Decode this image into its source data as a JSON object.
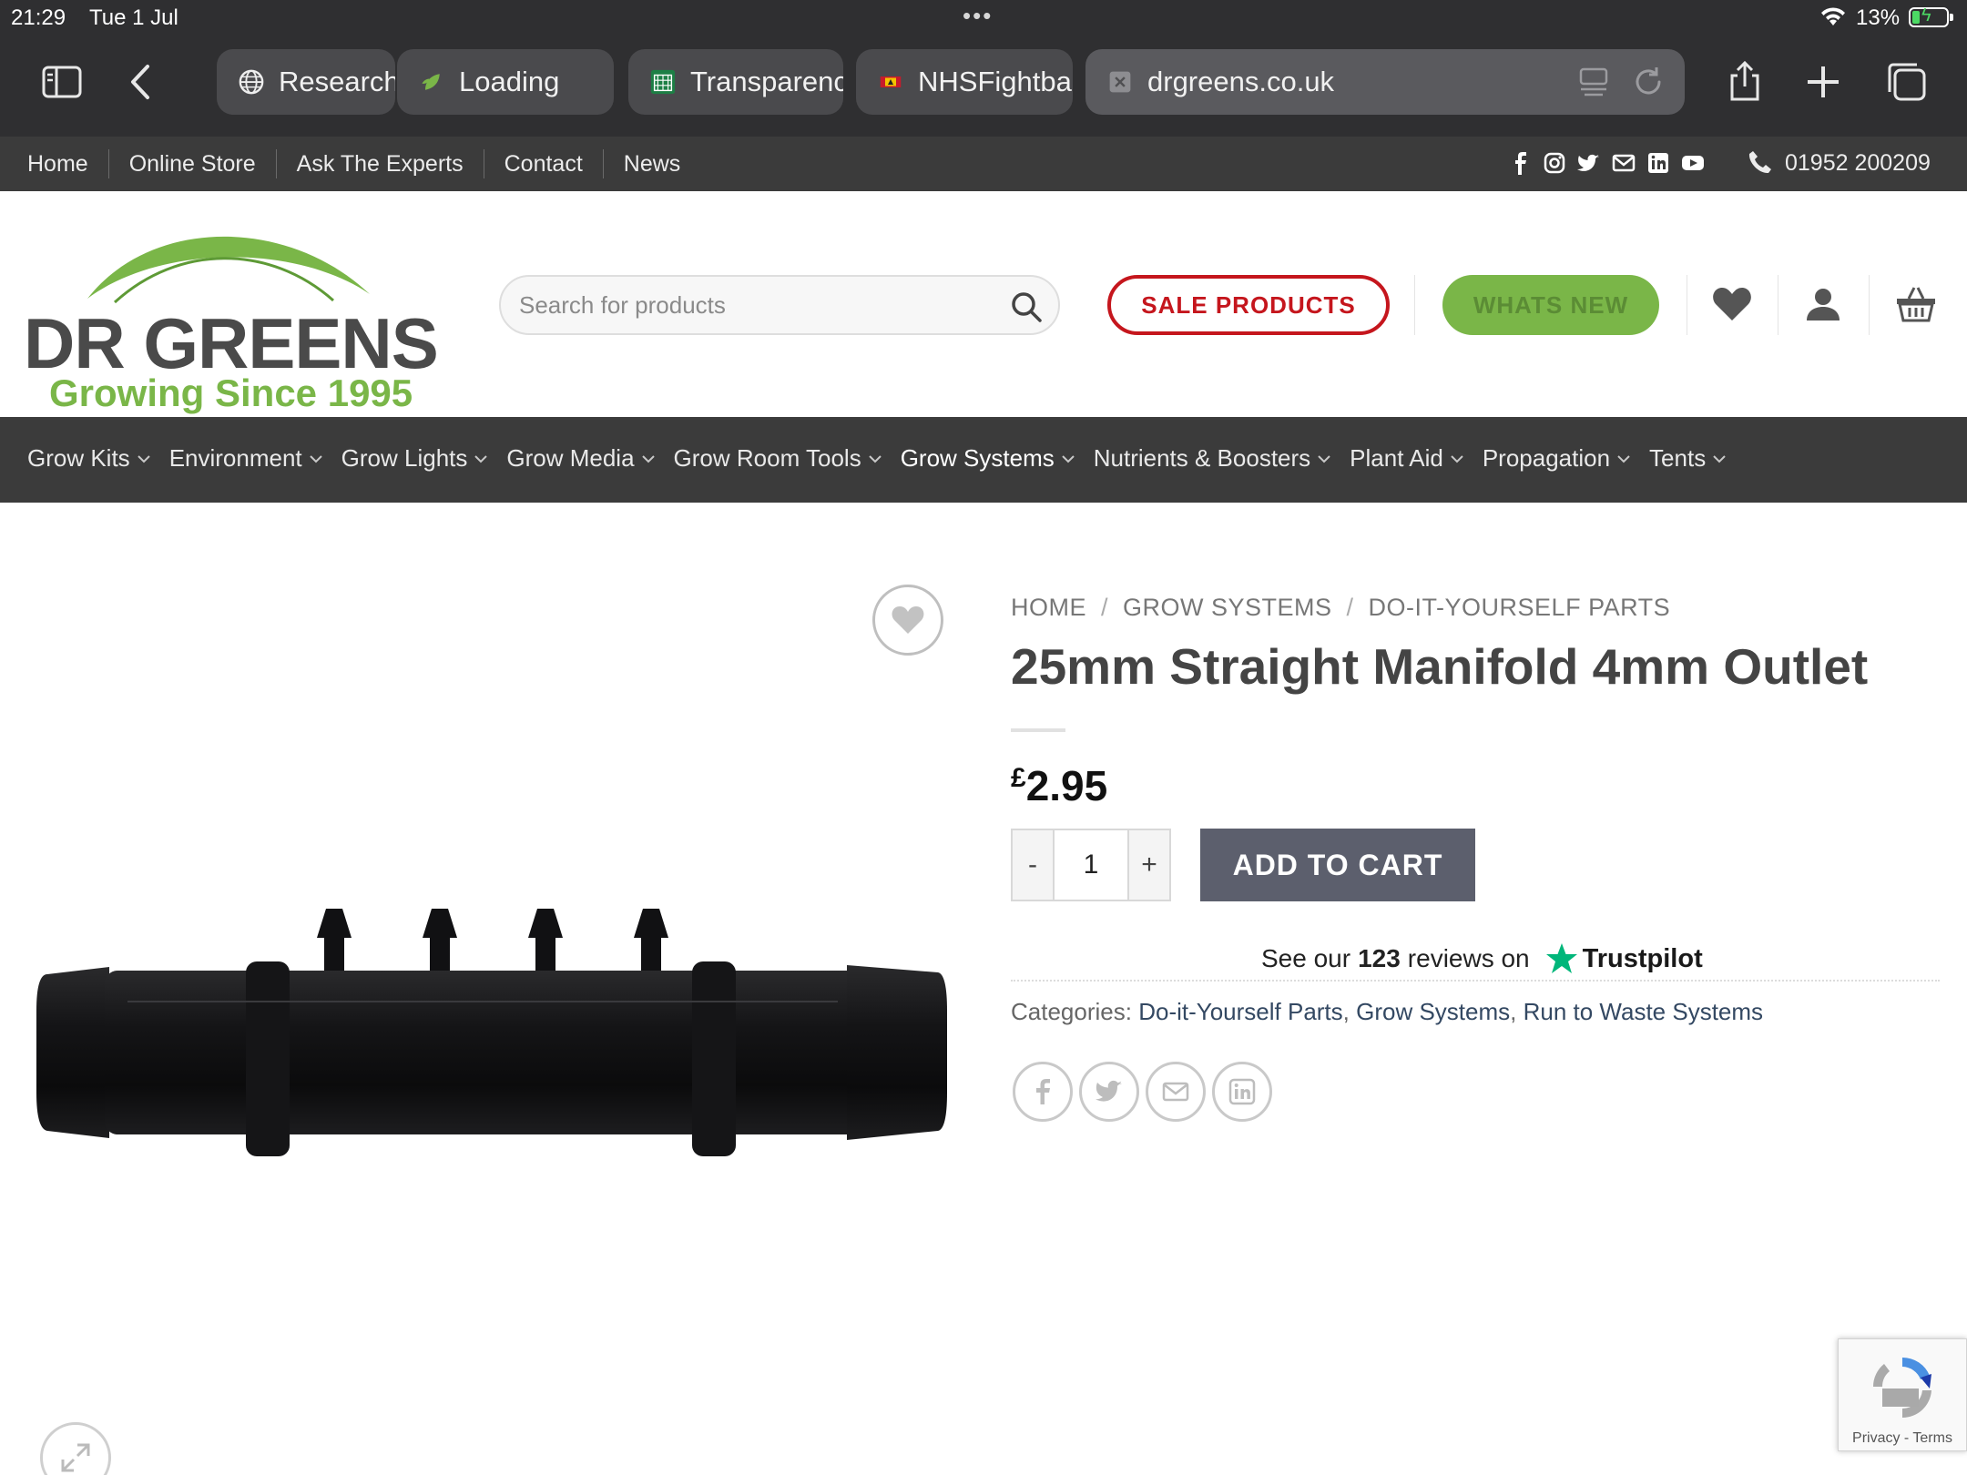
{
  "status_bar": {
    "time": "21:29",
    "date": "Tue 1 Jul",
    "battery": "13%"
  },
  "browser": {
    "tabs": [
      {
        "label": "Research",
        "icon": "globe-icon"
      },
      {
        "label": "Loading",
        "icon": "leaf-icon"
      },
      {
        "label": "Transparenc",
        "icon": "parliament-icon"
      },
      {
        "label": "NHSFightba",
        "icon": "nhs-icon"
      }
    ],
    "active_url": "drgreens.co.uk"
  },
  "topbar": {
    "links": [
      "Home",
      "Online Store",
      "Ask The Experts",
      "Contact",
      "News"
    ],
    "social_icons": [
      "facebook-icon",
      "instagram-icon",
      "twitter-icon",
      "email-icon",
      "linkedin-icon",
      "youtube-icon"
    ],
    "phone": "01952 200209"
  },
  "header": {
    "logo_name": "DR GREENS",
    "logo_tagline": "Growing Since 1995",
    "search_placeholder": "Search for products",
    "sale_label": "SALE PRODUCTS",
    "new_label": "WHATS NEW"
  },
  "main_nav": [
    {
      "label": "Grow Kits"
    },
    {
      "label": "Environment"
    },
    {
      "label": "Grow Lights"
    },
    {
      "label": "Grow Media"
    },
    {
      "label": "Grow Room Tools"
    },
    {
      "label": "Grow Systems",
      "active": true
    },
    {
      "label": "Nutrients & Boosters"
    },
    {
      "label": "Plant Aid"
    },
    {
      "label": "Propagation"
    },
    {
      "label": "Tents"
    }
  ],
  "product": {
    "breadcrumb": [
      "HOME",
      "GROW SYSTEMS",
      "DO-IT-YOURSELF PARTS"
    ],
    "title": "25mm Straight Manifold 4mm Outlet",
    "currency": "£",
    "price": "2.95",
    "quantity": "1",
    "qty_minus": "-",
    "qty_plus": "+",
    "add_to_cart": "ADD TO CART",
    "trustpilot": {
      "prefix": "See our",
      "count": "123",
      "suffix": "reviews on",
      "brand": "Trustpilot"
    },
    "categories_label": "Categories:",
    "categories": [
      "Do-it-Yourself Parts",
      "Grow Systems",
      "Run to Waste Systems"
    ],
    "share_icons": [
      "facebook-icon",
      "twitter-icon",
      "email-icon",
      "linkedin-icon"
    ]
  },
  "recaptcha": {
    "privacy": "Privacy",
    "terms": "Terms"
  },
  "colors": {
    "brand_green": "#7ab648",
    "sale_red": "#c5161d",
    "nav_bg": "#3b3b3b",
    "cart_button": "#5c5f6d",
    "trustpilot_green": "#00b67a"
  }
}
